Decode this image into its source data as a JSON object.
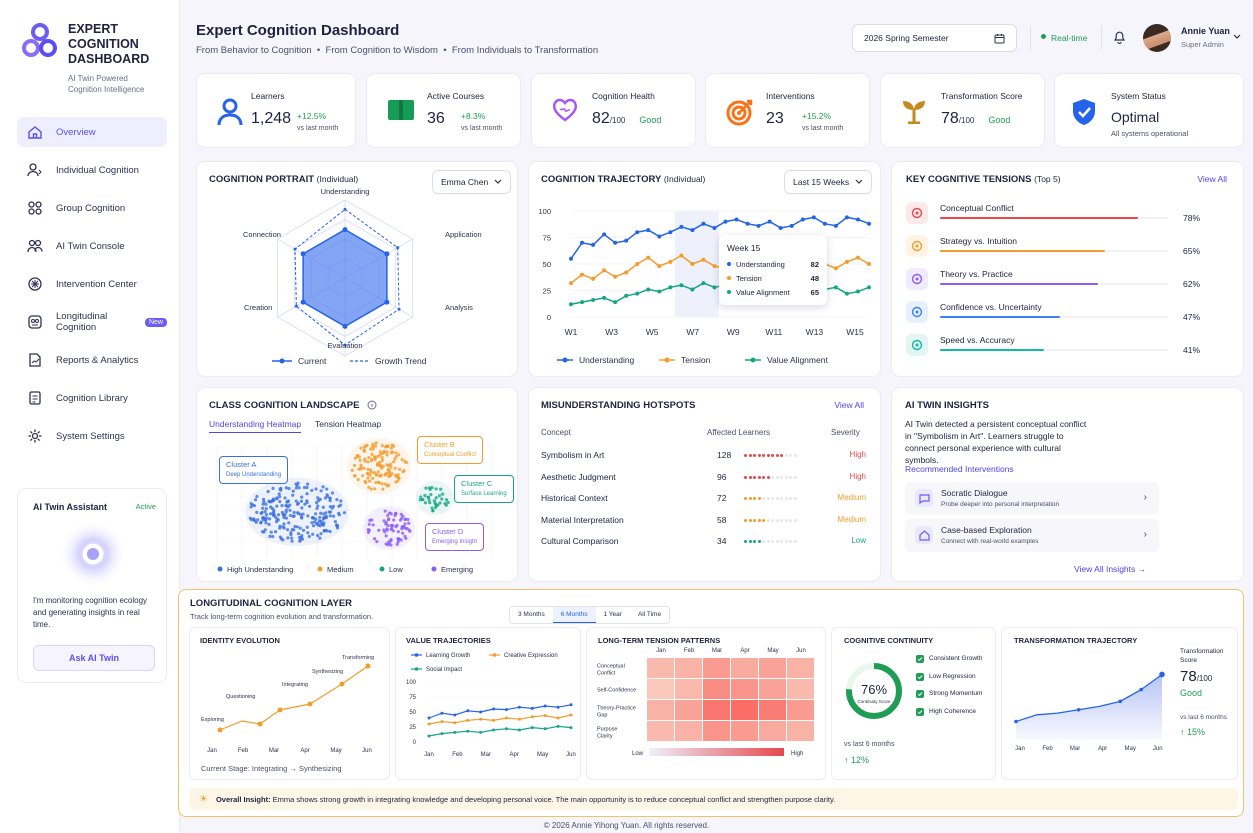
{
  "brand": {
    "line1": "EXPERT",
    "line2": "COGNITION",
    "line3": "DASHBOARD",
    "sub1": "AI Twin Powered",
    "sub2": "Cognition Intelligence"
  },
  "nav": [
    {
      "label": "Overview",
      "icon": "home-icon",
      "active": true
    },
    {
      "label": "Individual Cognition",
      "icon": "person-icon"
    },
    {
      "label": "Group Cognition",
      "icon": "group-icon"
    },
    {
      "label": "AI Twin Console",
      "icon": "twin-icon"
    },
    {
      "label": "Intervention Center",
      "icon": "intervention-icon"
    },
    {
      "label": "Longitudinal Cognition",
      "icon": "longitudinal-icon",
      "badge": "New"
    },
    {
      "label": "Reports & Analytics",
      "icon": "report-icon"
    },
    {
      "label": "Cognition Library",
      "icon": "library-icon"
    },
    {
      "label": "System Settings",
      "icon": "gear-icon"
    }
  ],
  "assistant": {
    "title": "AI Twin Assistant",
    "status": "Active",
    "message": "I'm monitoring cognition ecology and generating insights in real time.",
    "button": "Ask AI Twin"
  },
  "header": {
    "title": "Expert Cognition Dashboard",
    "subtitle": "From Behavior to Cognition  •  From Cognition to Wisdom  •  From Individuals to Transformation",
    "semester": "2026 Spring Semester",
    "realtime": "Real-time",
    "user_name": "Annie Yuan",
    "user_role": "Super Admin"
  },
  "kpis": [
    {
      "label": "Learners",
      "value": "1,248",
      "delta": "+12.5%",
      "note": "vs last month"
    },
    {
      "label": "Active Courses",
      "value": "36",
      "delta": "+8.3%",
      "note": "vs last month"
    },
    {
      "label": "Cognition Health",
      "value": "82",
      "unit": "/100",
      "status": "Good"
    },
    {
      "label": "Interventions",
      "value": "23",
      "delta": "+15.2%",
      "note": "vs last month"
    },
    {
      "label": "Transformation Score",
      "value": "78",
      "unit": "/100",
      "status": "Good"
    },
    {
      "label": "System Status",
      "value": "Optimal",
      "note": "All systems operational"
    }
  ],
  "portrait": {
    "title": "COGNITION PORTRAIT",
    "scope": "(Individual)",
    "select": "Emma Chen",
    "axes": [
      "Understanding",
      "Application",
      "Analysis",
      "Evaluation",
      "Creation",
      "Connection"
    ],
    "current": [
      0.62,
      0.62,
      0.62,
      0.62,
      0.62,
      0.62
    ],
    "trend": [
      0.88,
      0.78,
      0.8,
      0.86,
      0.72,
      0.74
    ],
    "legend_current": "Current",
    "legend_trend": "Growth Trend"
  },
  "trajectory": {
    "title": "COGNITION TRAJECTORY",
    "scope": "(Individual)",
    "select": "Last 15 Weeks",
    "ticks_y": [
      "100",
      "75",
      "50",
      "25",
      "0"
    ],
    "ticks_x": [
      "W1",
      "W3",
      "W5",
      "W7",
      "W9",
      "W11",
      "W13",
      "W15"
    ],
    "series": [
      {
        "name": "Understanding",
        "color": "#2563eb",
        "values": [
          55,
          70,
          68,
          78,
          70,
          72,
          80,
          82,
          76,
          80,
          85,
          82,
          88,
          84,
          90,
          92,
          88,
          86,
          90,
          84,
          86,
          92,
          94,
          88,
          86,
          94,
          92,
          88
        ]
      },
      {
        "name": "Tension",
        "color": "#f39c2c",
        "values": [
          32,
          40,
          36,
          44,
          38,
          42,
          50,
          56,
          48,
          52,
          58,
          50,
          54,
          48,
          46,
          52,
          50,
          44,
          48,
          40,
          46,
          52,
          48,
          50,
          46,
          52,
          56,
          50
        ]
      },
      {
        "name": "Value Alignment",
        "color": "#17a589",
        "values": [
          12,
          14,
          16,
          18,
          14,
          20,
          22,
          26,
          24,
          28,
          30,
          26,
          32,
          28,
          30,
          26,
          22,
          24,
          26,
          22,
          20,
          24,
          22,
          26,
          28,
          22,
          24,
          28
        ]
      }
    ],
    "tooltip": {
      "title": "Week 15",
      "rows": [
        {
          "label": "Understanding",
          "value": "82"
        },
        {
          "label": "Tension",
          "value": "48"
        },
        {
          "label": "Value Alignment",
          "value": "65"
        }
      ]
    }
  },
  "tensions": {
    "title": "KEY COGNITIVE TENSIONS",
    "scope": "(Top 5)",
    "link": "View All",
    "items": [
      {
        "label": "Conceptual Conflict",
        "pct": "78%",
        "value": 0.78,
        "color": "#e5484d"
      },
      {
        "label": "Strategy vs. Intuition",
        "pct": "65%",
        "value": 0.65,
        "color": "#f39c2c"
      },
      {
        "label": "Theory vs. Practice",
        "pct": "62%",
        "value": 0.62,
        "color": "#8b5cf6"
      },
      {
        "label": "Confidence vs. Uncertainty",
        "pct": "47%",
        "value": 0.47,
        "color": "#3b82f6"
      },
      {
        "label": "Speed vs. Accuracy",
        "pct": "41%",
        "value": 0.41,
        "color": "#14b8a6"
      }
    ]
  },
  "landscape": {
    "title": "CLASS COGNITION LANDSCAPE",
    "tab1": "Understanding Heatmap",
    "tab2": "Tension Heatmap",
    "clusters": [
      {
        "name": "Cluster A",
        "desc": "Deep Understanding",
        "color": "#3b6fe0"
      },
      {
        "name": "Cluster B",
        "desc": "Conceptual Conflict",
        "color": "#f39c2c"
      },
      {
        "name": "Cluster C",
        "desc": "Surface Learning",
        "color": "#17a589"
      },
      {
        "name": "Cluster D",
        "desc": "Emerging Insight",
        "color": "#8b5cf6"
      }
    ],
    "legend": [
      "High Understanding",
      "Medium",
      "Low",
      "Emerging"
    ]
  },
  "hotspots": {
    "title": "MISUNDERSTANDING HOTSPOTS",
    "link": "View All",
    "headers": [
      "Concept",
      "Affected Learners",
      "Severity"
    ],
    "rows": [
      {
        "concept": "Symbolism in Art",
        "count": "128",
        "dots": 9,
        "severity": "High",
        "color": "#e5484d"
      },
      {
        "concept": "Aesthetic Judgment",
        "count": "96",
        "dots": 6,
        "severity": "High",
        "color": "#e5484d"
      },
      {
        "concept": "Historical Context",
        "count": "72",
        "dots": 4,
        "severity": "Medium",
        "color": "#f39c2c"
      },
      {
        "concept": "Material Interpretation",
        "count": "58",
        "dots": 5,
        "severity": "Medium",
        "color": "#f39c2c"
      },
      {
        "concept": "Cultural Comparison",
        "count": "34",
        "dots": 4,
        "severity": "Low",
        "color": "#17a589"
      }
    ]
  },
  "insights": {
    "title": "AI TWIN INSIGHTS",
    "text": "AI Twin detected a persistent conceptual conflict in \"Symbolism in Art\". Learners struggle to connect personal experience with cultural symbols.",
    "rec_title": "Recommended Interventions",
    "recs": [
      {
        "title": "Socratic Dialogue",
        "desc": "Probe deeper into personal interpretation"
      },
      {
        "title": "Case-based Exploration",
        "desc": "Connect with real-world examples"
      }
    ],
    "link": "View All Insights"
  },
  "longitudinal": {
    "title": "LONGITUDINAL COGNITION LAYER",
    "subtitle": "Track long-term cognition evolution and transformation.",
    "ranges": [
      "3 Months",
      "6 Months",
      "1 Year",
      "All Time"
    ],
    "active_range": "6 Months",
    "months": [
      "Jan",
      "Feb",
      "Mar",
      "Apr",
      "May",
      "Jun"
    ],
    "identity": {
      "title": "IDENTITY EVOLUTION",
      "stages": [
        "Exploring",
        "Questioning",
        "Integrating",
        "Synthesizing",
        "Transforming"
      ],
      "footer": "Current Stage: Integrating → Synthesizing"
    },
    "values": {
      "title": "VALUE TRAJECTORIES",
      "legend": [
        "Learning Growth",
        "Creative Expression",
        "Social Impact"
      ],
      "ticks_y": [
        "100",
        "75",
        "50",
        "25",
        "0"
      ],
      "series": [
        {
          "name": "Learning Growth",
          "color": "#2563eb",
          "values": [
            40,
            48,
            45,
            52,
            50,
            55,
            54,
            58,
            56,
            60,
            58,
            62
          ]
        },
        {
          "name": "Creative Expression",
          "color": "#f39c2c",
          "values": [
            30,
            34,
            32,
            36,
            38,
            36,
            40,
            38,
            42,
            44,
            40,
            45
          ]
        },
        {
          "name": "Social Impact",
          "color": "#17a589",
          "values": [
            10,
            14,
            16,
            18,
            16,
            20,
            22,
            20,
            24,
            22,
            26,
            24
          ]
        }
      ]
    },
    "tension_patterns": {
      "title": "LONG-TERM TENSION PATTERNS",
      "rows": [
        "Conceptual Conflict",
        "Self-Confidence",
        "Theory-Practice Gap",
        "Purpose Clarity"
      ],
      "matrix": [
        [
          0.3,
          0.35,
          0.5,
          0.4,
          0.45,
          0.35
        ],
        [
          0.2,
          0.3,
          0.6,
          0.55,
          0.45,
          0.3
        ],
        [
          0.35,
          0.45,
          0.75,
          0.8,
          0.7,
          0.5
        ],
        [
          0.3,
          0.35,
          0.55,
          0.5,
          0.4,
          0.35
        ]
      ],
      "low": "Low",
      "high": "High"
    },
    "continuity": {
      "title": "COGNITIVE CONTINUITY",
      "value": "76%",
      "value_num": 0.76,
      "label": "Continuity Score",
      "items": [
        "Consistent Growth",
        "Low Regression",
        "Strong Momentum",
        "High Coherence"
      ],
      "note": "vs last 6 months",
      "delta": "↑ 12%"
    },
    "transformation": {
      "title": "TRANSFORMATION TRAJECTORY",
      "score_label": "Transformation Score",
      "score": "78",
      "unit": "/100",
      "status": "Good",
      "note": "vs last 6 months",
      "delta": "↑ 15%",
      "values": [
        22,
        30,
        32,
        36,
        40,
        46,
        60,
        78
      ]
    },
    "overall_label": "Overall Insight:",
    "overall": "Emma shows strong growth in integrating knowledge and developing personal voice. The main opportunity is to reduce conceptual conflict and strengthen purpose clarity."
  },
  "footer": "© 2026 Annie Yihong Yuan. All rights reserved."
}
